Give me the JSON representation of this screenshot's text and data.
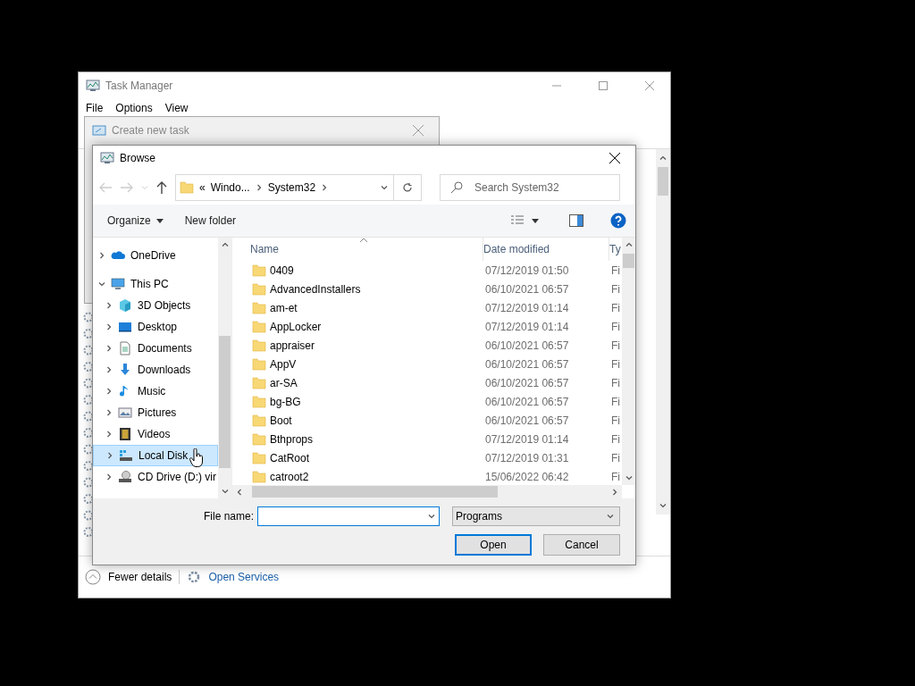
{
  "task_manager": {
    "title": "Task Manager",
    "menu": [
      "File",
      "Options",
      "View"
    ],
    "fewer_details": "Fewer details",
    "open_services": "Open Services"
  },
  "create_new_task": {
    "title": "Create new task"
  },
  "browse": {
    "title": "Browse",
    "address": {
      "overflow": "«",
      "segments": [
        "Windo...",
        "System32"
      ]
    },
    "search": {
      "placeholder": "Search System32"
    },
    "toolbar": {
      "organize": "Organize",
      "new_folder": "New folder"
    },
    "nav_tree": [
      {
        "label": "OneDrive",
        "kind": "cloud",
        "expanded": false,
        "selected": false
      },
      {
        "label": "This PC",
        "kind": "computer",
        "expanded": true,
        "selected": false,
        "children": [
          {
            "label": "3D Objects",
            "kind": "cube",
            "expanded": false,
            "selected": false
          },
          {
            "label": "Desktop",
            "kind": "desktop",
            "expanded": false,
            "selected": false
          },
          {
            "label": "Documents",
            "kind": "document",
            "expanded": false,
            "selected": false
          },
          {
            "label": "Downloads",
            "kind": "download",
            "expanded": false,
            "selected": false
          },
          {
            "label": "Music",
            "kind": "music",
            "expanded": false,
            "selected": false
          },
          {
            "label": "Pictures",
            "kind": "pictures",
            "expanded": false,
            "selected": false
          },
          {
            "label": "Videos",
            "kind": "video",
            "expanded": false,
            "selected": false
          },
          {
            "label": "Local Disk",
            "kind": "disk",
            "expanded": false,
            "selected": true
          },
          {
            "label": "CD Drive (D:) vir",
            "kind": "cd",
            "expanded": false,
            "selected": false
          }
        ]
      }
    ],
    "columns": [
      "Name",
      "Date modified",
      "Ty"
    ],
    "rows": [
      {
        "name": "0409",
        "date": "07/12/2019 01:50",
        "type": "Fi",
        "selected": false
      },
      {
        "name": "AdvancedInstallers",
        "date": "06/10/2021 06:57",
        "type": "Fi",
        "selected": false
      },
      {
        "name": "am-et",
        "date": "07/12/2019 01:14",
        "type": "Fi",
        "selected": false
      },
      {
        "name": "AppLocker",
        "date": "07/12/2019 01:14",
        "type": "Fi",
        "selected": false
      },
      {
        "name": "appraiser",
        "date": "06/10/2021 06:57",
        "type": "Fi",
        "selected": false
      },
      {
        "name": "AppV",
        "date": "06/10/2021 06:57",
        "type": "Fi",
        "selected": false
      },
      {
        "name": "ar-SA",
        "date": "06/10/2021 06:57",
        "type": "Fi",
        "selected": false
      },
      {
        "name": "bg-BG",
        "date": "06/10/2021 06:57",
        "type": "Fi",
        "selected": false
      },
      {
        "name": "Boot",
        "date": "06/10/2021 06:57",
        "type": "Fi",
        "selected": false
      },
      {
        "name": "Bthprops",
        "date": "07/12/2019 01:14",
        "type": "Fi",
        "selected": false
      },
      {
        "name": "CatRoot",
        "date": "07/12/2019 01:31",
        "type": "Fi",
        "selected": false
      },
      {
        "name": "catroot2",
        "date": "15/06/2022 06:42",
        "type": "Fi",
        "selected": false
      }
    ],
    "file_name": {
      "label": "File name:"
    },
    "file_type": "Programs",
    "buttons": {
      "open": "Open",
      "cancel": "Cancel"
    }
  }
}
